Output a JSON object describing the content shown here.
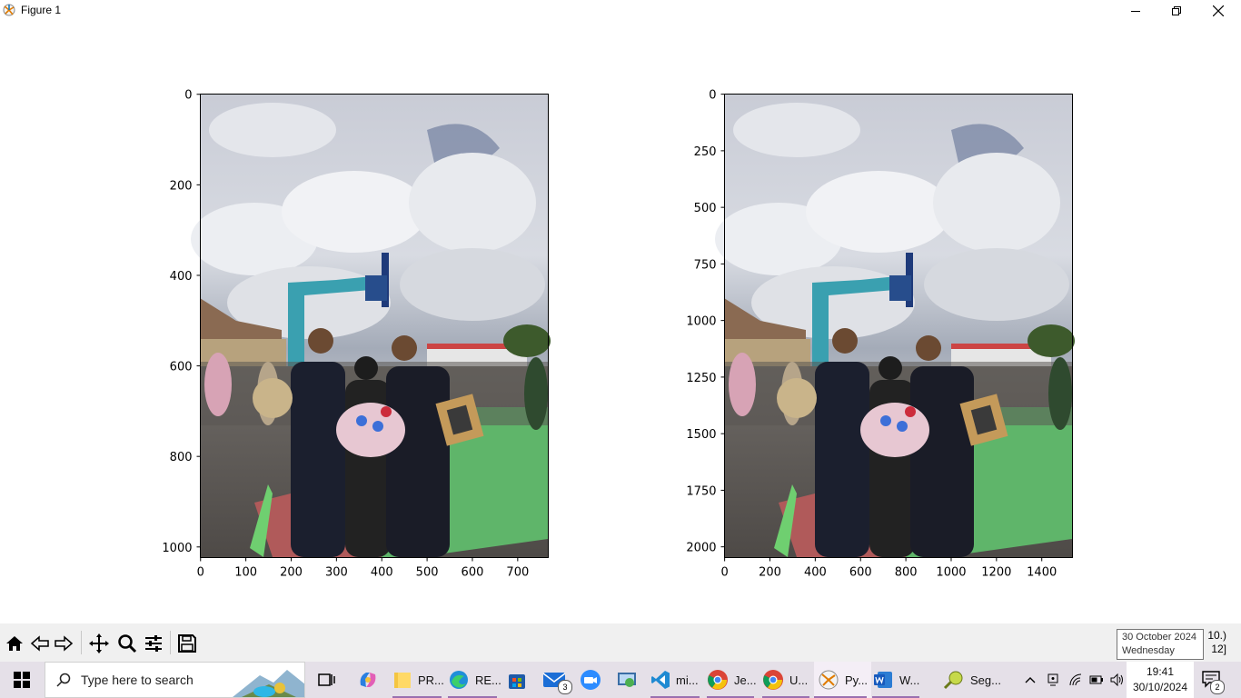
{
  "window": {
    "title": "Figure 1",
    "controls": [
      "minimize-icon",
      "restore-icon",
      "close-icon"
    ]
  },
  "figure": {
    "image_left": {
      "name": "group photo at basketball court (original resolution)",
      "yticks": [
        "0",
        "200",
        "400",
        "600",
        "800",
        "1000"
      ],
      "xticks": [
        "0",
        "100",
        "200",
        "300",
        "400",
        "500",
        "600",
        "700"
      ]
    },
    "image_right": {
      "name": "group photo at basketball court (upscaled resolution)",
      "yticks": [
        "0",
        "250",
        "500",
        "750",
        "1000",
        "1250",
        "1500",
        "1750",
        "2000"
      ],
      "xticks": [
        "0",
        "200",
        "400",
        "600",
        "800",
        "1000",
        "1200",
        "1400"
      ]
    }
  },
  "toolbar": {
    "buttons": [
      "home-icon",
      "back-icon",
      "forward-icon",
      "pan-icon",
      "zoom-icon",
      "configure-subplots-icon",
      "save-icon"
    ],
    "coords_line1": "10.)",
    "coords_line2": "12]"
  },
  "tooltip": {
    "line1": "30 October 2024",
    "line2": "Wednesday"
  },
  "taskbar": {
    "search_placeholder": "Type here to search",
    "items": [
      {
        "label": "PR...",
        "icon": "file-explorer-icon"
      },
      {
        "label": "RE...",
        "icon": "edge-icon"
      },
      {
        "label": "mi...",
        "icon": "vscode-icon"
      },
      {
        "label": "Je...",
        "icon": "chrome-icon"
      },
      {
        "label": "U...",
        "icon": "chrome-icon"
      },
      {
        "label": "Py...",
        "icon": "python-icon"
      },
      {
        "label": "W...",
        "icon": "word-icon"
      },
      {
        "label": "Seg...",
        "icon": "app-icon"
      }
    ],
    "mail_badge": "3",
    "notification_badge": "2",
    "clock_time": "19:41",
    "clock_date": "30/10/2024"
  }
}
